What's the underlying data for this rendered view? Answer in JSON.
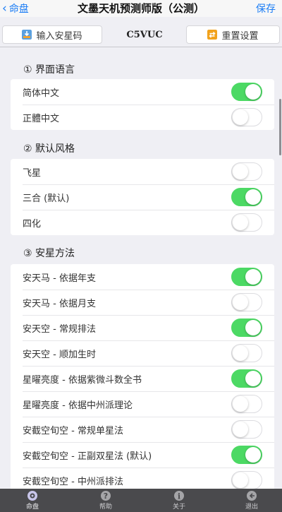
{
  "nav": {
    "back_label": "命盘",
    "title": "文墨天机预测师版（公测）",
    "save_label": "保存"
  },
  "codebar": {
    "input_label": "输入安星码",
    "code": "C5VUC",
    "reset_label": "重置设置"
  },
  "sections": [
    {
      "header": "① 界面语言",
      "rows": [
        {
          "label": "简体中文",
          "on": true
        },
        {
          "label": "正體中文",
          "on": false
        }
      ]
    },
    {
      "header": "② 默认风格",
      "rows": [
        {
          "label": "飞星",
          "on": false
        },
        {
          "label": "三合 (默认)",
          "on": true
        },
        {
          "label": "四化",
          "on": false
        }
      ]
    },
    {
      "header": "③ 安星方法",
      "rows": [
        {
          "label": "安天马 - 依据年支",
          "on": true
        },
        {
          "label": "安天马 - 依据月支",
          "on": false
        },
        {
          "label": "安天空 - 常规排法",
          "on": true
        },
        {
          "label": "安天空 - 顺加生时",
          "on": false
        },
        {
          "label": "星曜亮度 - 依据紫微斗数全书",
          "on": true
        },
        {
          "label": "星曜亮度 - 依据中州派理论",
          "on": false
        },
        {
          "label": "安截空旬空 - 常规单星法",
          "on": false
        },
        {
          "label": "安截空旬空 - 正副双星法 (默认)",
          "on": true
        },
        {
          "label": "安截空旬空 - 中州派排法",
          "on": false
        }
      ]
    }
  ],
  "tabbar": {
    "tabs": [
      {
        "label": "命盘",
        "icon": "chart-icon",
        "active": true
      },
      {
        "label": "帮助",
        "icon": "help-icon",
        "active": false
      },
      {
        "label": "关于",
        "icon": "info-icon",
        "active": false
      },
      {
        "label": "退出",
        "icon": "exit-icon",
        "active": false
      }
    ]
  },
  "colors": {
    "accent": "#1a7cf5",
    "toggle_on": "#4cd964",
    "tabbar_bg": "#4a4a4d"
  }
}
